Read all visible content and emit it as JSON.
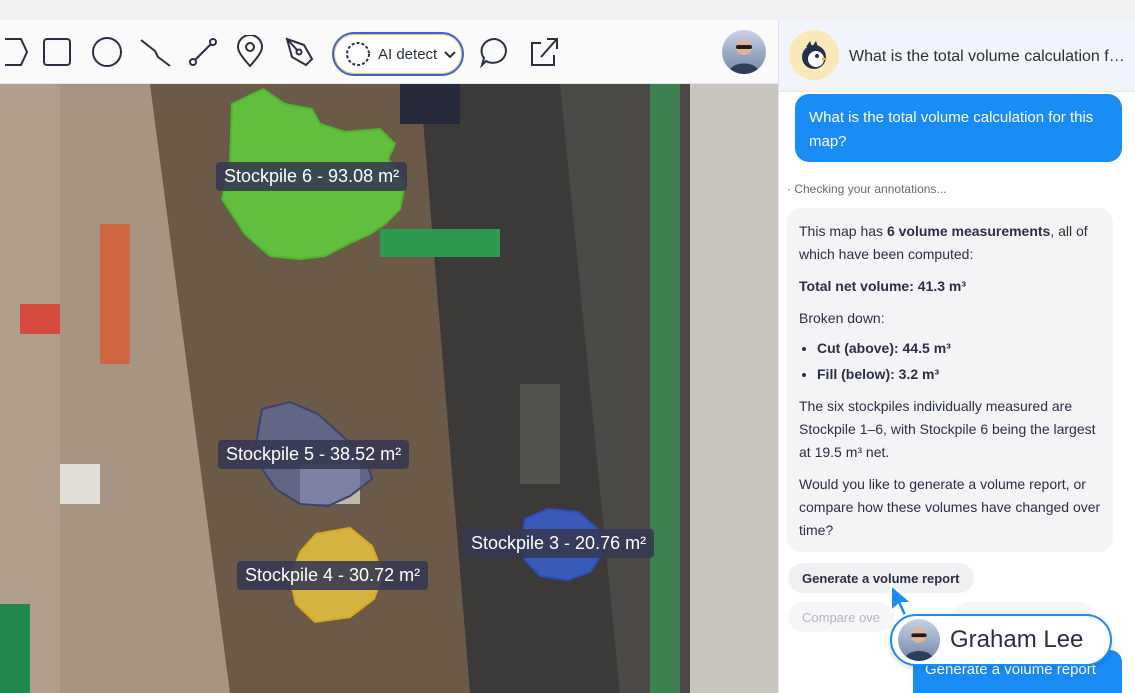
{
  "toolbar": {
    "tools": [
      "polygon-icon",
      "rectangle-icon",
      "circle-icon",
      "polyline-icon",
      "line-icon",
      "location-pin-icon",
      "pen-tool-icon"
    ],
    "ai_detect_label": "AI detect",
    "comment_icon": "comment-icon",
    "share_icon": "share-icon"
  },
  "map": {
    "labels": [
      {
        "id": "stockpile-6",
        "text": "Stockpile 6 - 93.08 m²"
      },
      {
        "id": "stockpile-5",
        "text": "Stockpile 5 - 38.52 m²"
      },
      {
        "id": "stockpile-4",
        "text": "Stockpile 4 - 30.72 m²"
      },
      {
        "id": "stockpile-3",
        "text": "Stockpile 3 - 20.76 m²"
      }
    ],
    "colors": {
      "stockpile6": "#5fd13c",
      "stockpile5": "#5f6aa0",
      "stockpile4": "#f0c93e",
      "stockpile3": "#3a66e0"
    }
  },
  "chat": {
    "title": "What is the total volume calculation for this map?",
    "user_message": "What is the total volume calculation for this map?",
    "status": "· Checking your annotations...",
    "answer": {
      "p1_pre": "This map has ",
      "p1_bold": "6 volume measurements",
      "p1_post": ", all of which have been computed:",
      "total": "Total net volume: 41.3 m³",
      "broken": "Broken down:",
      "cut": "Cut (above): 44.5 m³",
      "fill": "Fill (below): 3.2 m³",
      "p4": "The six stockpiles individually measured are Stockpile 1–6, with Stockpile 6 being the largest at 19.5 m³ net.",
      "p5": "Would you like to generate a volume report, or compare how these volumes have changed over time?"
    },
    "chips": {
      "generate": "Generate a volume report",
      "compare": "Compare ove",
      "third": ""
    },
    "sent_message": "Generate a volume report"
  },
  "cursor_user": {
    "name": "Graham Lee"
  },
  "accent": "#1a8cf5"
}
